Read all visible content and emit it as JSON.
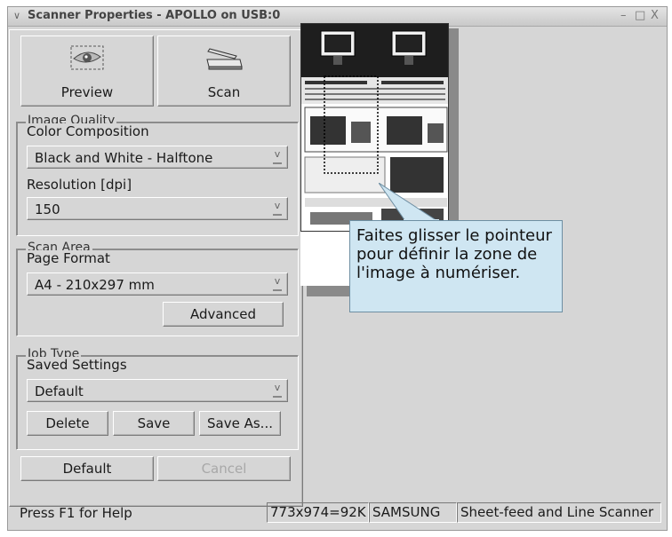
{
  "window": {
    "title": "Scanner Properties - APOLLO on USB:0",
    "menu_glyph": "∨",
    "minimize_glyph": "–",
    "maximize_glyph": "□",
    "close_glyph": "X"
  },
  "toolbar": {
    "preview_label": "Preview",
    "scan_label": "Scan"
  },
  "image_quality": {
    "group_title": "Image Quality",
    "color_label": "Color Composition",
    "color_value": "Black and White - Halftone",
    "resolution_label": "Resolution [dpi]",
    "resolution_value": "150"
  },
  "scan_area": {
    "group_title": "Scan Area",
    "format_label": "Page Format",
    "format_value": "A4 - 210x297 mm",
    "advanced_label": "Advanced"
  },
  "job_type": {
    "group_title": "Job Type",
    "settings_label": "Saved Settings",
    "settings_value": "Default",
    "delete_label": "Delete",
    "save_label": "Save",
    "save_as_label": "Save As..."
  },
  "footer_buttons": {
    "default_label": "Default",
    "cancel_label": "Cancel"
  },
  "tooltip": {
    "text": "Faites glisser le pointeur pour définir la zone de l'image à numériser."
  },
  "status_bar": {
    "help": "Press F1 for Help",
    "image_size": "773x974=92K",
    "vendor": "SAMSUNG",
    "scanner_type": "Sheet-feed and Line Scanner"
  },
  "icons": {
    "preview": "eye-scan-icon",
    "scan": "flatbed-scanner-icon"
  },
  "colors": {
    "window_bg": "#d6d6d6",
    "tooltip_bg": "#cfe6f2"
  }
}
